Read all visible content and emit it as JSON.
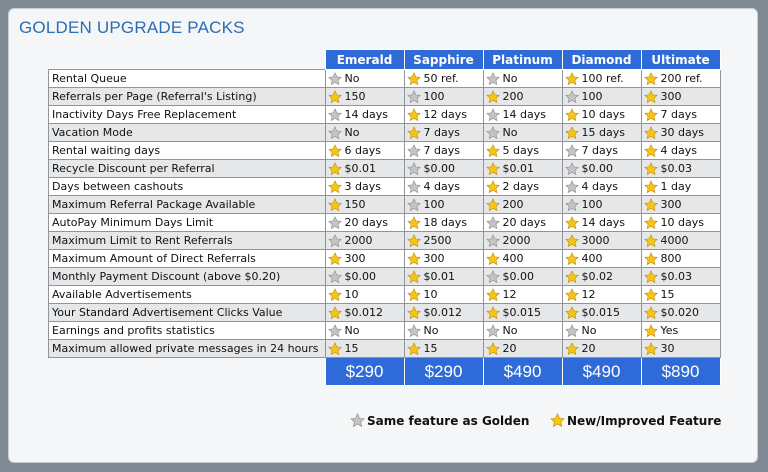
{
  "title": "GOLDEN UPGRADE PACKS",
  "packs": [
    "Emerald",
    "Sapphire",
    "Platinum",
    "Diamond",
    "Ultimate"
  ],
  "rows": [
    {
      "feature": "Rental Queue",
      "cells": [
        [
          "g",
          "No"
        ],
        [
          "y",
          "50 ref."
        ],
        [
          "g",
          "No"
        ],
        [
          "y",
          "100 ref."
        ],
        [
          "y",
          "200 ref."
        ]
      ]
    },
    {
      "feature": "Referrals per Page (Referral's Listing)",
      "cells": [
        [
          "y",
          "150"
        ],
        [
          "g",
          "100"
        ],
        [
          "y",
          "200"
        ],
        [
          "g",
          "100"
        ],
        [
          "y",
          "300"
        ]
      ]
    },
    {
      "feature": "Inactivity Days Free Replacement",
      "cells": [
        [
          "g",
          "14 days"
        ],
        [
          "y",
          "12 days"
        ],
        [
          "g",
          "14 days"
        ],
        [
          "y",
          "10 days"
        ],
        [
          "y",
          "7 days"
        ]
      ]
    },
    {
      "feature": "Vacation Mode",
      "cells": [
        [
          "g",
          "No"
        ],
        [
          "y",
          "7 days"
        ],
        [
          "g",
          "No"
        ],
        [
          "y",
          "15 days"
        ],
        [
          "y",
          "30 days"
        ]
      ]
    },
    {
      "feature": "Rental waiting days",
      "cells": [
        [
          "y",
          "6 days"
        ],
        [
          "g",
          "7 days"
        ],
        [
          "y",
          "5 days"
        ],
        [
          "g",
          "7 days"
        ],
        [
          "y",
          "4 days"
        ]
      ]
    },
    {
      "feature": "Recycle Discount per Referral",
      "cells": [
        [
          "y",
          "$0.01"
        ],
        [
          "g",
          "$0.00"
        ],
        [
          "y",
          "$0.01"
        ],
        [
          "g",
          "$0.00"
        ],
        [
          "y",
          "$0.03"
        ]
      ]
    },
    {
      "feature": "Days between cashouts",
      "cells": [
        [
          "y",
          "3 days"
        ],
        [
          "g",
          "4 days"
        ],
        [
          "y",
          "2 days"
        ],
        [
          "g",
          "4 days"
        ],
        [
          "y",
          "1 day"
        ]
      ]
    },
    {
      "feature": "Maximum Referral Package Available",
      "cells": [
        [
          "y",
          "150"
        ],
        [
          "g",
          "100"
        ],
        [
          "y",
          "200"
        ],
        [
          "g",
          "100"
        ],
        [
          "y",
          "300"
        ]
      ]
    },
    {
      "feature": "AutoPay Minimum Days Limit",
      "cells": [
        [
          "g",
          "20 days"
        ],
        [
          "y",
          "18 days"
        ],
        [
          "g",
          "20 days"
        ],
        [
          "y",
          "14 days"
        ],
        [
          "y",
          "10 days"
        ]
      ]
    },
    {
      "feature": "Maximum Limit to Rent Referrals",
      "cells": [
        [
          "g",
          "2000"
        ],
        [
          "y",
          "2500"
        ],
        [
          "g",
          "2000"
        ],
        [
          "y",
          "3000"
        ],
        [
          "y",
          "4000"
        ]
      ]
    },
    {
      "feature": "Maximum Amount of Direct Referrals",
      "cells": [
        [
          "y",
          "300"
        ],
        [
          "y",
          "300"
        ],
        [
          "y",
          "400"
        ],
        [
          "y",
          "400"
        ],
        [
          "y",
          "800"
        ]
      ]
    },
    {
      "feature": "Monthly Payment Discount (above $0.20)",
      "cells": [
        [
          "g",
          "$0.00"
        ],
        [
          "y",
          "$0.01"
        ],
        [
          "g",
          "$0.00"
        ],
        [
          "y",
          "$0.02"
        ],
        [
          "y",
          "$0.03"
        ]
      ]
    },
    {
      "feature": "Available Advertisements",
      "cells": [
        [
          "y",
          "10"
        ],
        [
          "y",
          "10"
        ],
        [
          "y",
          "12"
        ],
        [
          "y",
          "12"
        ],
        [
          "y",
          "15"
        ]
      ]
    },
    {
      "feature": "Your Standard Advertisement Clicks Value",
      "cells": [
        [
          "y",
          "$0.012"
        ],
        [
          "y",
          "$0.012"
        ],
        [
          "y",
          "$0.015"
        ],
        [
          "y",
          "$0.015"
        ],
        [
          "y",
          "$0.020"
        ]
      ]
    },
    {
      "feature": "Earnings and profits statistics",
      "cells": [
        [
          "g",
          "No"
        ],
        [
          "g",
          "No"
        ],
        [
          "g",
          "No"
        ],
        [
          "g",
          "No"
        ],
        [
          "y",
          "Yes"
        ]
      ]
    },
    {
      "feature": "Maximum allowed private messages in 24 hours",
      "cells": [
        [
          "y",
          "15"
        ],
        [
          "y",
          "15"
        ],
        [
          "y",
          "20"
        ],
        [
          "y",
          "20"
        ],
        [
          "y",
          "30"
        ]
      ]
    }
  ],
  "prices": [
    "$290",
    "$290",
    "$490",
    "$490",
    "$890"
  ],
  "legend": {
    "same": "Same feature as Golden",
    "improved": "New/Improved Feature"
  },
  "colors": {
    "header_blue": "#2e6bd8",
    "title_blue": "#2a6db5",
    "star_gold": "#f5c518",
    "star_gray": "#c4c4c4"
  },
  "icons": {
    "g": "gray-star-icon",
    "y": "gold-star-icon"
  }
}
